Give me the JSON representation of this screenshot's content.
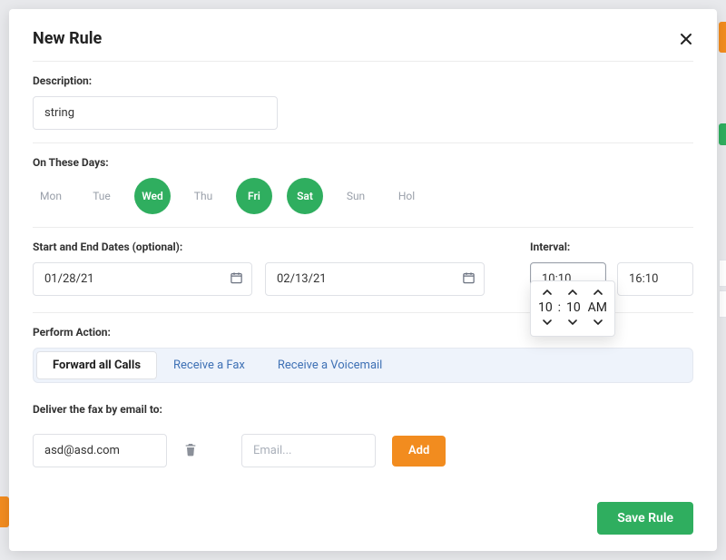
{
  "modal": {
    "title": "New Rule",
    "description_label": "Description:",
    "description_value": "string",
    "days_label": "On These Days:",
    "days": [
      {
        "abbr": "Mon",
        "selected": false
      },
      {
        "abbr": "Tue",
        "selected": false
      },
      {
        "abbr": "Wed",
        "selected": true
      },
      {
        "abbr": "Thu",
        "selected": false
      },
      {
        "abbr": "Fri",
        "selected": true
      },
      {
        "abbr": "Sat",
        "selected": true
      },
      {
        "abbr": "Sun",
        "selected": false
      },
      {
        "abbr": "Hol",
        "selected": false
      }
    ],
    "dates_label": "Start and End Dates (optional):",
    "start_date": "01/28/21",
    "end_date": "02/13/21",
    "interval_label": "Interval:",
    "interval_start": "10:10",
    "interval_end": "16:10",
    "time_picker": {
      "hour": "10",
      "minute": "10",
      "meridiem": "AM"
    },
    "action_label": "Perform Action:",
    "action_tabs": [
      "Forward all Calls",
      "Receive a Fax",
      "Receive a Voicemail"
    ],
    "action_active": 0,
    "deliver_label": "Deliver the fax by email to:",
    "email_value": "asd@asd.com",
    "email_placeholder": "Email...",
    "add_label": "Add",
    "save_label": "Save Rule"
  }
}
